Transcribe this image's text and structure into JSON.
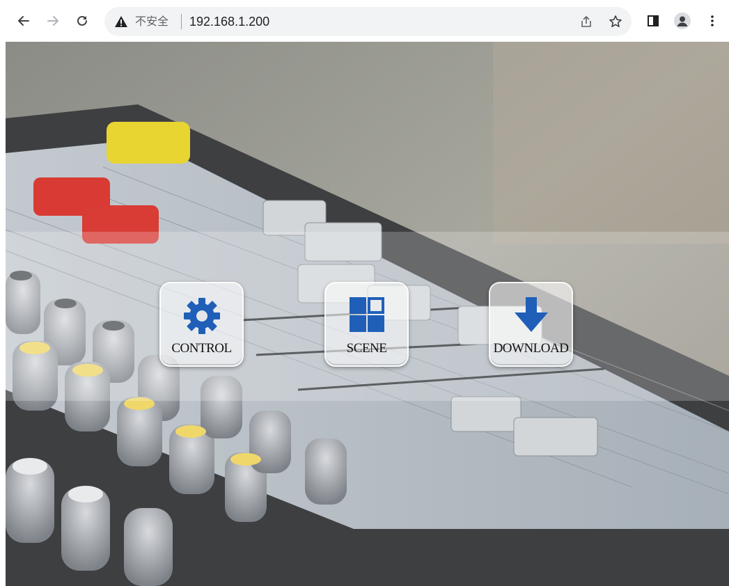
{
  "browser": {
    "security_label": "不安全",
    "url": "192.168.1.200",
    "icons": {
      "back": "arrow-left-icon",
      "forward": "arrow-right-icon",
      "reload": "reload-icon",
      "warning": "warning-triangle-icon",
      "share": "share-icon",
      "bookmark": "star-icon",
      "sidepanel": "side-panel-icon",
      "profile": "profile-avatar-icon",
      "menu": "kebab-menu-icon"
    }
  },
  "tiles": [
    {
      "label": "CONTROL",
      "icon": "gear-icon",
      "color": "#1f5fb8"
    },
    {
      "label": "SCENE",
      "icon": "grid-icon",
      "color": "#1f5fb8"
    },
    {
      "label": "DOWNLOAD",
      "icon": "download-arrow-icon",
      "color": "#1f5fb8"
    }
  ]
}
